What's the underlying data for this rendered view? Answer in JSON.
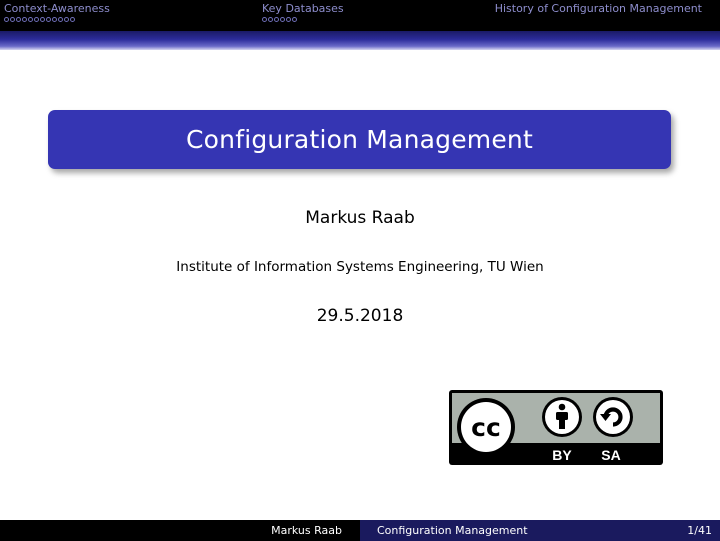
{
  "navigation": {
    "sections": [
      {
        "label": "Context-Awareness",
        "frame_count": 12
      },
      {
        "label": "Key Databases",
        "frame_count": 6
      },
      {
        "label": "History of Configuration Management",
        "frame_count": 0
      }
    ]
  },
  "slide": {
    "title": "Configuration Management",
    "author": "Markus Raab",
    "institute": "Institute of Information Systems Engineering, TU Wien",
    "date": "29.5.2018"
  },
  "license_badge": {
    "cc_text": "cc",
    "by_label": "BY",
    "sa_label": "SA"
  },
  "footer": {
    "author": "Markus Raab",
    "title": "Configuration Management",
    "page": "1/41"
  },
  "colors": {
    "accent": "#3535b3",
    "nav_text": "#8d8dcc",
    "footer_title_bg": "#1a1a5e"
  }
}
